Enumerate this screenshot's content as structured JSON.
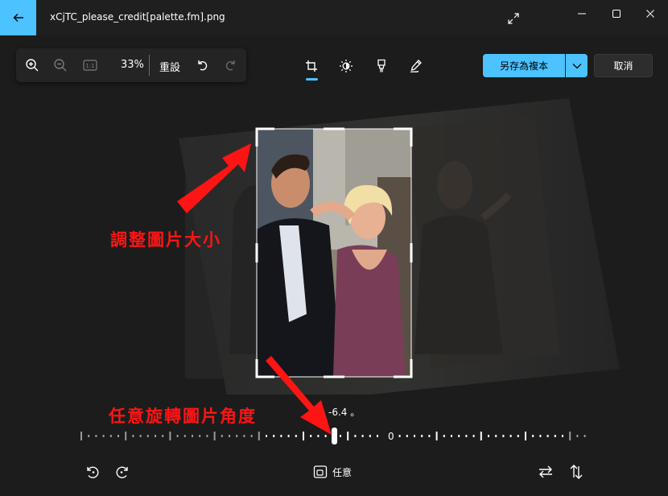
{
  "window": {
    "title": "xCjTC_please_credit[palette.fm].png",
    "back_icon": "arrow-left-icon",
    "expand_icon": "expand-diagonal-icon",
    "minimize_icon": "minimize-icon",
    "maximize_icon": "maximize-icon",
    "close_icon": "close-icon",
    "accent_color": "#4cc2ff"
  },
  "zoom_toolbar": {
    "zoom_in_icon": "zoom-in-icon",
    "zoom_out_icon": "zoom-out-icon",
    "fit_icon": "actual-size-icon",
    "fit_label": "1:1",
    "zoom_level": "33%",
    "reset_label": "重設",
    "undo_icon": "undo-icon",
    "redo_icon": "redo-icon"
  },
  "edit_tabs": [
    {
      "name": "crop",
      "icon": "crop-icon",
      "active": true
    },
    {
      "name": "adjust",
      "icon": "brightness-icon",
      "active": false
    },
    {
      "name": "filter",
      "icon": "filter-icon",
      "active": false
    },
    {
      "name": "markup",
      "icon": "markup-pen-icon",
      "active": false
    }
  ],
  "actions": {
    "save_copy_label": "另存為複本",
    "save_dropdown_icon": "chevron-down-icon",
    "cancel_label": "取消"
  },
  "annotations": {
    "resize_label": "調整圖片大小",
    "rotate_label": "任意旋轉圖片角度",
    "arrow_color": "#ff1414"
  },
  "rotation": {
    "angle_readout": "-6.4 。",
    "angle_value": -6.4,
    "ruler_zero_label": "0"
  },
  "bottom_bar": {
    "rotate_left_icon": "rotate-left-icon",
    "rotate_right_icon": "rotate-right-icon",
    "aspect_icon": "aspect-ratio-icon",
    "aspect_label": "任意",
    "flip_horizontal_icon": "flip-horizontal-icon",
    "flip_vertical_icon": "flip-vertical-icon"
  }
}
